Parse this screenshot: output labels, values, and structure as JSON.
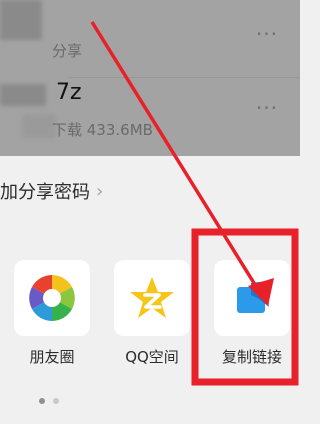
{
  "file_list": {
    "rows": [
      {
        "title": "",
        "subtitle": "分享",
        "more": "···"
      },
      {
        "title": "7z",
        "subtitle": "下载 433.6MB",
        "more": "···"
      }
    ]
  },
  "share_sheet": {
    "password_option": "加分享密码",
    "password_chevron": "›",
    "targets": [
      {
        "label": "朋友圈",
        "icon": "moments-icon"
      },
      {
        "label": "QQ空间",
        "icon": "qzone-icon"
      },
      {
        "label": "复制链接",
        "icon": "copy-link-icon"
      }
    ],
    "page_indicator": {
      "pages": 2,
      "current": 1
    }
  },
  "annotation": {
    "color": "#e8202a"
  }
}
